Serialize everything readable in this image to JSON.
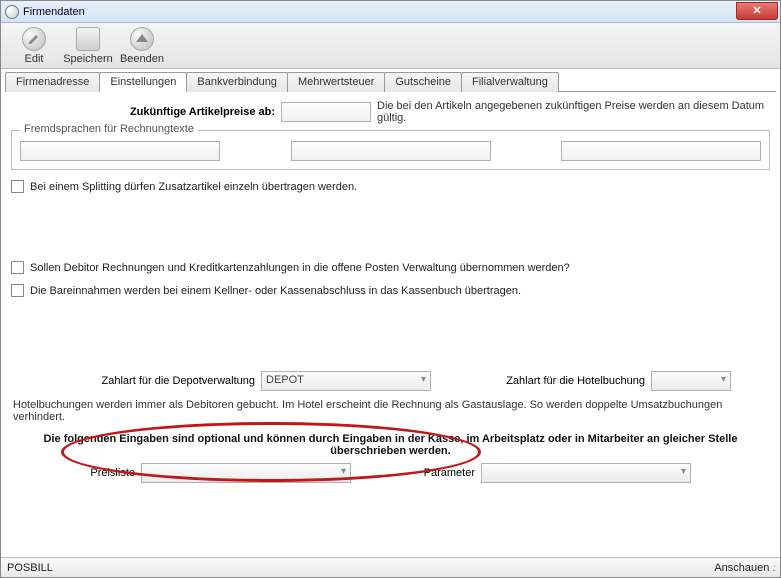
{
  "window": {
    "title": "Firmendaten"
  },
  "toolbar": {
    "edit": "Edit",
    "save": "Speichern",
    "quit": "Beenden"
  },
  "tabs": {
    "t0": "Firmenadresse",
    "t1": "Einstellungen",
    "t2": "Bankverbindung",
    "t3": "Mehrwertsteuer",
    "t4": "Gutscheine",
    "t5": "Filialverwaltung"
  },
  "settings": {
    "future_prices_label": "Zukünftige Artikelpreise ab:",
    "future_prices_value": "",
    "future_prices_help": "Die bei den Artikeln angegebenen zukünftigen Preise werden an diesem Datum gültig.",
    "lang_legend": "Fremdsprachen für Rechnungtexte",
    "lang1": "",
    "lang2": "",
    "lang3": "",
    "chk_splitting": "Bei einem Splitting dürfen Zusatzartikel einzeln übertragen werden.",
    "chk_debitor": "Sollen Debitor Rechnungen und Kreditkartenzahlungen in die offene Posten Verwaltung übernommen werden?",
    "chk_bareinnahmen": "Die Bareinnahmen werden bei einem Kellner- oder Kassenabschluss in das Kassenbuch übertragen.",
    "depot_label": "Zahlart für die Depotverwaltung",
    "depot_value": "DEPOT",
    "hotel_label": "Zahlart für die Hotelbuchung",
    "hotel_value": "",
    "hotel_note": "Hotelbuchungen werden immer als Debitoren gebucht. Im Hotel erscheint die Rechnung als Gastauslage. So werden doppelte Umsatzbuchungen verhindert.",
    "optional_note": "Die folgenden Eingaben sind optional und können durch Eingaben in der Kasse, im Arbeitsplatz oder in Mitarbeiter an gleicher Stelle überschrieben werden.",
    "preisliste_label": "Preisliste",
    "preisliste_value": "",
    "parameter_label": "Parameter",
    "parameter_value": ""
  },
  "status": {
    "left": "POSBILL",
    "right": "Anschauen"
  }
}
